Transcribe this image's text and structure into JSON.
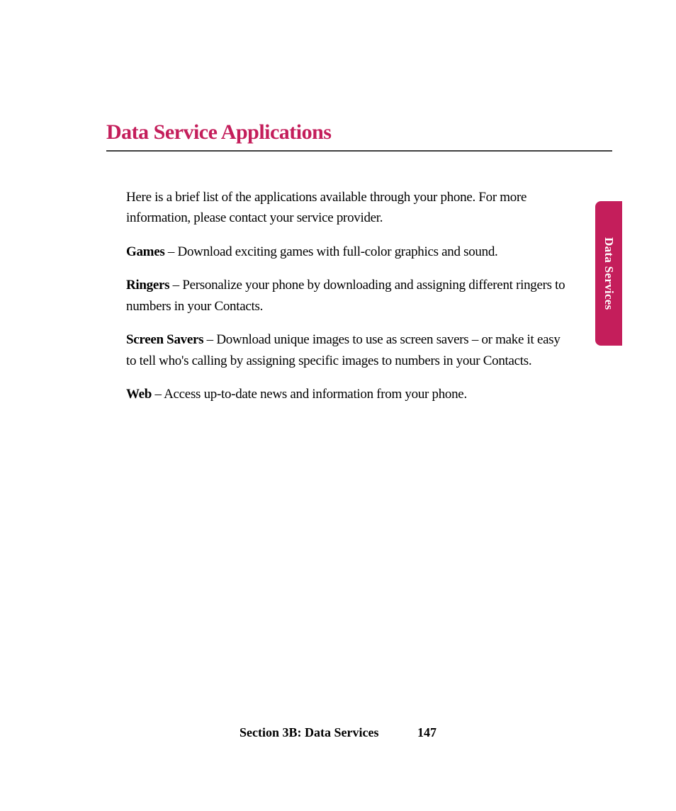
{
  "heading": "Data Service Applications",
  "intro": "Here is a brief list of the applications available through your phone. For more information, please contact your service provider.",
  "features": [
    {
      "label": "Games",
      "separator": " – ",
      "description": "Download exciting games with full-color graphics and sound."
    },
    {
      "label": "Ringers",
      "separator": " – ",
      "description": "Personalize your phone by downloading and assigning different ringers to numbers in your Contacts."
    },
    {
      "label": "Screen Savers",
      "separator": " – ",
      "description": "Download unique images to use as screen savers – or make it easy to tell who's calling by assigning specific images to numbers in your Contacts."
    },
    {
      "label": "Web",
      "separator": " – ",
      "description": "Access up-to-date news and information from your phone."
    }
  ],
  "sideTab": "Data Services",
  "footer": {
    "section": "Section 3B: Data Services",
    "page": "147"
  }
}
